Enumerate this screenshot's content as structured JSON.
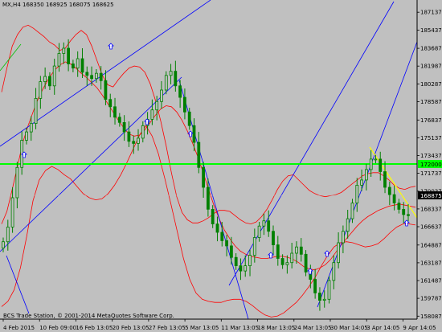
{
  "window": {
    "header_text": "MX,H4  168350 168925 168075 168625",
    "copyright": "BCS Trade Station, © 2001-2014 MetaQuotes Software Corp."
  },
  "colors": {
    "background": "#c0c0c0",
    "candle": "#008000",
    "bands": "#ff0000",
    "channel": "#0000ff",
    "horizontal_level": "#00ff00",
    "trendline_light": "#ffff00",
    "trendline_green": "#00c000",
    "fractal_arrow": "#0000ff"
  },
  "chart_data": {
    "type": "candlestick",
    "symbol": "MX",
    "timeframe": "H4",
    "ohlc": {
      "open": 168350,
      "high": 168925,
      "low": 168075,
      "close": 168625
    },
    "ylim": [
      157800,
      188000
    ],
    "y_ticks": [
      187137,
      185437,
      183687,
      181987,
      180287,
      178587,
      176837,
      175137,
      173437,
      171737,
      170037,
      168337,
      166637,
      164887,
      163187,
      161487,
      159787,
      158087
    ],
    "x_ticks": [
      "4 Feb 2015",
      "10 Feb 09:00",
      "16 Feb 13:05",
      "20 Feb 13:05",
      "27 Feb 13:05",
      "5 Mar 13:05",
      "11 Mar 13:05",
      "18 Mar 13:05",
      "24 Mar 13:05",
      "30 Mar 14:05",
      "3 Apr 14:05",
      "9 Apr 14:05"
    ],
    "horizontal_level": {
      "value": 172000,
      "label": "172000"
    },
    "current_price": {
      "value": 168875,
      "label": "168875"
    },
    "closes": [
      165200,
      166600,
      169400,
      172300,
      174900,
      175700,
      176500,
      178900,
      180500,
      181000,
      180100,
      182000,
      183200,
      183700,
      182200,
      181800,
      182700,
      181400,
      181100,
      180800,
      181300,
      180600,
      178800,
      178100,
      177100,
      176600,
      175700,
      174800,
      174600,
      175100,
      176300,
      176900,
      177800,
      178600,
      179700,
      181100,
      181500,
      180100,
      179000,
      177600,
      176300,
      174700,
      172300,
      170400,
      168300,
      166900,
      166100,
      165300,
      164800,
      163700,
      162900,
      162400,
      162900,
      163900,
      165600,
      166700,
      167200,
      166200,
      164900,
      163600,
      163000,
      163200,
      164100,
      164700,
      164000,
      162300,
      161600,
      160300,
      159600,
      159700,
      161500,
      163200,
      165100,
      166200,
      167400,
      168900,
      170600,
      171100,
      172100,
      173100,
      173100,
      171900,
      170400,
      169700,
      168900,
      168300,
      167800,
      167700
    ],
    "bands_mid": [
      166900,
      168100,
      170200,
      172400,
      174700,
      176300,
      177700,
      179000,
      180000,
      180900,
      181600,
      182100,
      182400,
      182200,
      181800,
      181300,
      180900,
      180400,
      179900,
      179200,
      178400,
      177600,
      176800,
      176100,
      175500,
      175300,
      175400,
      175900,
      176600,
      177300,
      177900,
      178200,
      178100,
      177600,
      176800,
      175800,
      174600,
      173300,
      171800,
      170200,
      168700,
      167400,
      166300,
      165500,
      164800,
      164300,
      164000,
      163800,
      163700,
      163600,
      163600,
      163700,
      163800,
      163800,
      163700,
      163500,
      163200,
      162800,
      162600,
      162500,
      162700,
      163000,
      163500,
      164200,
      164900,
      165500,
      166100,
      166700,
      167200,
      167600,
      167900,
      168200,
      168400,
      168600,
      168700,
      168800,
      168700,
      168600,
      168500
    ],
    "bands_upper": [
      179500,
      181800,
      183900,
      185000,
      185700,
      185900,
      185600,
      185200,
      184800,
      184300,
      184000,
      183500,
      183700,
      184400,
      185000,
      185400,
      185000,
      183900,
      182500,
      181100,
      180200,
      180000,
      180700,
      181300,
      181800,
      182000,
      181900,
      181400,
      180300,
      178700,
      176700,
      174400,
      171800,
      169500,
      168000,
      167300,
      167000,
      167000,
      167200,
      167500,
      167900,
      168200,
      168200,
      168100,
      167700,
      167300,
      167000,
      166900,
      167100,
      167600,
      168300,
      169200,
      170200,
      171000,
      171500,
      171600,
      171100,
      170600,
      170100,
      169800,
      169600,
      169500,
      169600,
      169700,
      169900,
      170300,
      170700,
      171100,
      171500,
      171700,
      171800,
      171800,
      171500,
      171100,
      170600,
      170300,
      170200,
      170400,
      170500
    ],
    "bands_lower": [
      159000,
      159500,
      160600,
      162700,
      165700,
      169100,
      171100,
      172000,
      172400,
      172100,
      171600,
      171200,
      170500,
      169800,
      169400,
      169200,
      169300,
      169800,
      170600,
      171600,
      172800,
      174100,
      175400,
      176300,
      175300,
      173600,
      171300,
      168800,
      166200,
      163600,
      161600,
      160300,
      159700,
      159500,
      159400,
      159400,
      159600,
      159700,
      159700,
      159500,
      159100,
      158600,
      158200,
      158000,
      158100,
      158400,
      158900,
      159400,
      160100,
      160900,
      161800,
      162900,
      163900,
      164700,
      165100,
      165200,
      165100,
      164900,
      164700,
      164800,
      165000,
      165500,
      166100,
      166600,
      166900,
      166900,
      166800
    ]
  }
}
